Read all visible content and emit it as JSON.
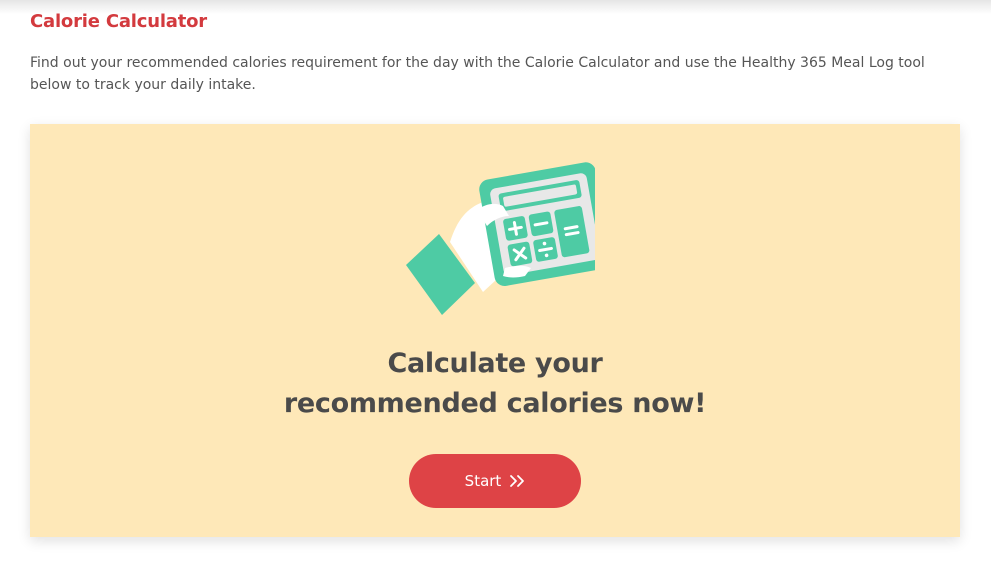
{
  "page": {
    "title": "Calorie Calculator",
    "intro": "Find out your recommended calories requirement for the day with the Calorie Calculator and use the Healthy 365 Meal Log tool below to track your daily intake."
  },
  "card": {
    "illustration_icon": "hand-holding-calculator-icon",
    "headline_line1": "Calculate your",
    "headline_line2": "recommended calories now!",
    "start_label": "Start",
    "start_icon": "double-chevron-right-icon"
  },
  "colors": {
    "title": "#d33a3e",
    "card_background": "#fee8b8",
    "button": "#de4346",
    "calculator": "#4ecba4",
    "headline": "#4a4a4a"
  }
}
